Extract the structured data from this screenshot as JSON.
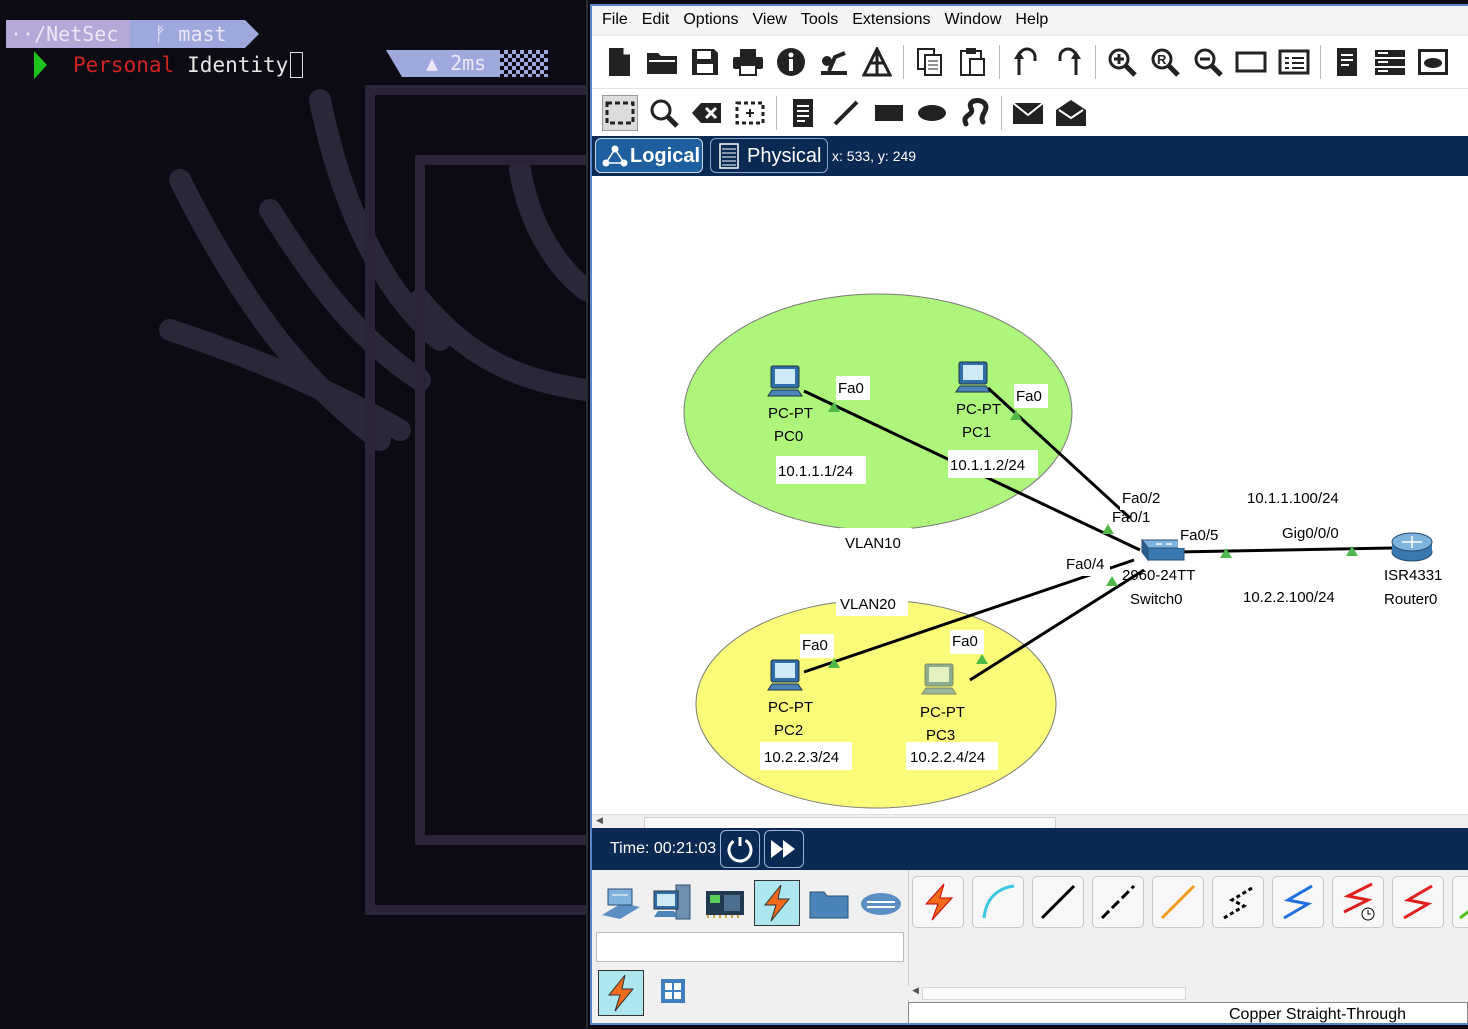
{
  "terminal": {
    "path": "··/NetSec",
    "git_branch": "ᚠ mast",
    "command_word1": "Personal",
    "command_word2": "Identity",
    "duration": "▲ 2ms"
  },
  "packet_tracer": {
    "menu": [
      "File",
      "Edit",
      "Options",
      "View",
      "Tools",
      "Extensions",
      "Window",
      "Help"
    ],
    "toolbar1_icons": [
      "new-file-icon",
      "open-folder-icon",
      "save-icon",
      "print-icon",
      "info-icon",
      "activity-wizard-icon",
      "network-tree-icon",
      "copy-icon",
      "paste-icon",
      "undo-icon",
      "redo-icon",
      "zoom-in-icon",
      "zoom-reset-icon",
      "zoom-out-icon",
      "rectangle-view-icon",
      "palette-icon",
      "custom-device-icon",
      "server-rack-icon",
      "cluster-view-icon"
    ],
    "toolbar2_icons": [
      "select-icon",
      "inspect-icon",
      "delete-icon",
      "resize-shape-icon",
      "note-icon",
      "draw-line-icon",
      "draw-rectangle-icon",
      "draw-ellipse-icon",
      "freeform-icon",
      "add-pdu-icon",
      "complex-pdu-icon"
    ],
    "tabs": {
      "logical": "Logical",
      "physical": "Physical"
    },
    "coords": "x: 533, y: 249",
    "topology": {
      "vlan10_label": "VLAN10",
      "vlan20_label": "VLAN20",
      "pc0": {
        "type": "PC-PT",
        "name": "PC0",
        "port": "Fa0",
        "ip": "10.1.1.1/24"
      },
      "pc1": {
        "type": "PC-PT",
        "name": "PC1",
        "port": "Fa0",
        "ip": "10.1.1.2/24"
      },
      "pc2": {
        "type": "PC-PT",
        "name": "PC2",
        "port": "Fa0",
        "ip": "10.2.2.3/24"
      },
      "pc3": {
        "type": "PC-PT",
        "name": "PC3",
        "port": "Fa0",
        "ip": "10.2.2.4/24"
      },
      "switch": {
        "type": "2960-24TT",
        "name": "Switch0",
        "port_fa02": "Fa0/2",
        "port_fa01": "Fa0/1",
        "port_fa04": "Fa0/4",
        "port_fa05": "Fa0/5"
      },
      "router": {
        "type": "ISR4331",
        "name": "Router0",
        "port": "Gig0/0/0",
        "ip1": "10.1.1.100/24",
        "ip2": "10.2.2.100/24"
      }
    },
    "sim_time": "Time: 00:21:03",
    "device_categories": [
      "network-devices-icon",
      "end-devices-icon",
      "components-icon",
      "connections-icon",
      "misc-icon",
      "multiuser-icon"
    ],
    "cable_types": [
      "automatic-connection-icon",
      "console-cable-icon",
      "copper-straight-through-icon",
      "copper-cross-over-icon",
      "fiber-icon",
      "phone-cable-icon",
      "coaxial-icon",
      "serial-dce-icon",
      "serial-dte-icon",
      "octal-cable-icon"
    ],
    "cable_status": "Copper Straight-Through",
    "colors": {
      "vlan10": "#aef67b",
      "vlan20": "#fbfb7a",
      "link_up": "#50b848",
      "accent_bar": "#0a2a54"
    }
  }
}
